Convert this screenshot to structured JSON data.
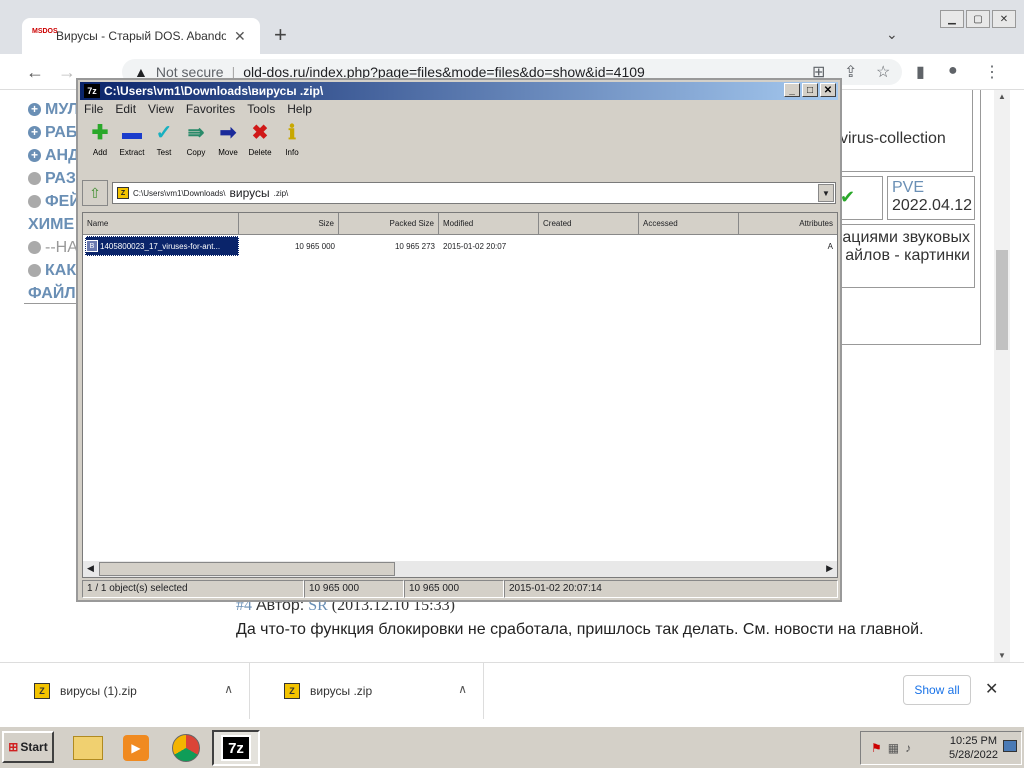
{
  "browser": {
    "tab_title": "Вирусы - Старый DOS. Abandonware",
    "tab_favicon": "MSDOS",
    "new_tab": "+",
    "not_secure": "Not secure",
    "url": "old-dos.ru/index.php?page=files&mode=files&do=show&id=4109"
  },
  "page": {
    "menu": [
      {
        "label": "МУЛ",
        "bullet": "plus"
      },
      {
        "label": "РАБ",
        "bullet": "plus"
      },
      {
        "label": "АНД",
        "bullet": "plus"
      },
      {
        "label": "РАЗ",
        "bullet": "circle"
      },
      {
        "label": "ФЕЙ",
        "bullet": "circle"
      },
      {
        "label": "ХИМЕ",
        "bullet": "none"
      },
      {
        "label": "--НА",
        "bullet": "circle"
      },
      {
        "label": "КАК",
        "bullet": "circle"
      },
      {
        "label": "ФАЙЛ",
        "bullet": "none"
      }
    ],
    "cell_collection": "virus-collection",
    "cell_user": "PVE",
    "cell_date": "2022.04.12",
    "cell_desc_1": "ациями звуковых",
    "cell_desc_2": "айлов - картинки",
    "comment_num": "#4",
    "comment_author_label": "Автор:",
    "comment_author": "SR",
    "comment_date": "(2013.12.10 15:33)",
    "comment_text": "Да что-то функция блокировки не сработала, пришлось так делать. См. новости на главной."
  },
  "sevenzip": {
    "logo": "7z",
    "title": "C:\\Users\\vm1\\Downloads\\вирусы .zip\\",
    "menu": [
      "File",
      "Edit",
      "View",
      "Favorites",
      "Tools",
      "Help"
    ],
    "tools": [
      {
        "label": "Add",
        "glyph": "✚",
        "color": "#2aa82a"
      },
      {
        "label": "Extract",
        "glyph": "▬",
        "color": "#1a3ccc"
      },
      {
        "label": "Test",
        "glyph": "✓",
        "color": "#18b0c0"
      },
      {
        "label": "Copy",
        "glyph": "⇛",
        "color": "#2a8a6a"
      },
      {
        "label": "Move",
        "glyph": "➡",
        "color": "#1a2a9a"
      },
      {
        "label": "Delete",
        "glyph": "✖",
        "color": "#d01818"
      },
      {
        "label": "Info",
        "glyph": "ℹ",
        "color": "#c8a800"
      }
    ],
    "path_small": "C:\\Users\\vm1\\Downloads\\",
    "path_big": "вирусы",
    "path_tail": ".zip\\",
    "columns": [
      "Name",
      "Size",
      "Packed Size",
      "Modified",
      "Created",
      "Accessed",
      "Attributes"
    ],
    "rows": [
      {
        "name": "1405800023_17_viruses-for-ant...",
        "size": "10 965 000",
        "packed": "10 965 273",
        "modified": "2015-01-02 20:07",
        "created": "",
        "accessed": "",
        "attributes": "A"
      }
    ],
    "status": [
      "1 / 1 object(s) selected",
      "10 965 000",
      "10 965 000",
      "2015-01-02 20:07:14"
    ]
  },
  "downloads": {
    "items": [
      {
        "name": "вирусы (1).zip"
      },
      {
        "name": "вирусы .zip"
      }
    ],
    "show_all": "Show all"
  },
  "taskbar": {
    "start": "Start",
    "time": "10:25 PM",
    "date": "5/28/2022"
  }
}
